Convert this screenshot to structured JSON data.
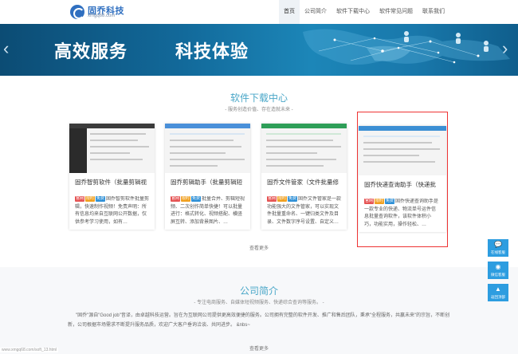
{
  "header": {
    "brand_name": "固乔科技",
    "brand_domain": "xmgq68.com",
    "nav": [
      {
        "label": "首页",
        "active": true
      },
      {
        "label": "公司简介",
        "active": false
      },
      {
        "label": "软件下载中心",
        "active": false
      },
      {
        "label": "软件常见问题",
        "active": false
      },
      {
        "label": "联系我们",
        "active": false
      }
    ]
  },
  "banner": {
    "text_left": "高效服务",
    "text_right": "科技体验",
    "prev_arrow": "‹",
    "next_arrow": "›"
  },
  "software": {
    "title": "软件下载中心",
    "subtitle": "- 服务创造价值、存在造就未来 -",
    "more": "查看更多",
    "cards": [
      {
        "title": "固乔智剪软件（批量剪辑视",
        "tags": [
          "官网",
          "限时",
          "免费"
        ],
        "desc": "固乔智剪软件批量剪辑，快速制作视频！免责声明：所有信息均来自互联网公开数据，仅供参考学习使用，如有…"
      },
      {
        "title": "固乔剪辑助手（批量剪辑短",
        "tags": [
          "官网",
          "限时",
          "免费"
        ],
        "desc": "批量合并、剪辑短视频、二次创作简单快捷！可以批量进行：格式转化、视频搭配、横竖屏互转、添加背景图片、…"
      },
      {
        "title": "固乔文件管家（文件批量修",
        "tags": [
          "官网",
          "限时",
          "免费"
        ],
        "desc": "固乔文件管家是一款功能强大的文件管家，可以实现文件批量重命名、一键归类文件及目录、文件数字序号设置、自定义…"
      },
      {
        "title": "固乔快递查询助手（快递批",
        "tags": [
          "官网",
          "限时",
          "免费"
        ],
        "desc": "固乔快递查询助手是一款专业的快递、物流单号运件信息批量查询软件，该软件体积小巧，功能实用，操作轻松、…"
      }
    ]
  },
  "about": {
    "title": "公司简介",
    "subtitle": "- 专注电商服务、自媒体短视频服务、快递综合查询等服务。 -",
    "body": "\"固乔\"源自\"Good job\"音译，由卓越科技运营。旨在为互联网公司提供更高效便捷的服务。公司拥有完整的软件开发、推广和售后团队，秉承\"全程服务，共赢未来\"的宗旨，不断创新，公司根据市场需求不断提升服务品质，欢迎广大客户垂询洽谈、共同进步。 &nbs~",
    "more": "查看更多",
    "status_url": "www.xmgq68.com/soft_13.html"
  },
  "widgets": [
    {
      "icon": "chat-icon",
      "label": "在线客服"
    },
    {
      "icon": "wechat-icon",
      "label": "微信客服"
    },
    {
      "icon": "top-icon",
      "label": "返回顶部"
    }
  ],
  "colors": {
    "brand_blue": "#2f6fc0",
    "section_title": "#4aa7c8",
    "highlight_border": "#ee3333",
    "widget_blue": "#2d9de0",
    "tag_red": "#e55353",
    "tag_orange": "#f0a020",
    "tag_blue": "#2d8fd6"
  }
}
